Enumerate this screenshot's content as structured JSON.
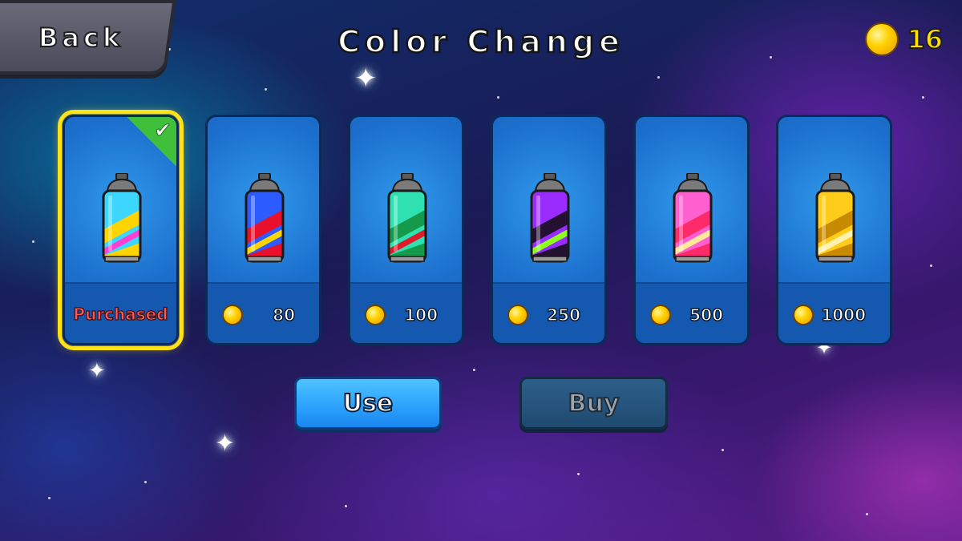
{
  "header": {
    "back_label": "Back",
    "title": "Color Change",
    "coin_balance": "16"
  },
  "cards": [
    {
      "price": "Purchased",
      "status": "purchased",
      "selected": true,
      "colors": [
        "#3cd6ff",
        "#ffd400",
        "#ff3fd0"
      ]
    },
    {
      "price": "80",
      "status": "locked",
      "selected": false,
      "colors": [
        "#2c5bff",
        "#e8102a",
        "#ffd400"
      ]
    },
    {
      "price": "100",
      "status": "locked",
      "selected": false,
      "colors": [
        "#2fe0b0",
        "#149a4a",
        "#e01a2a"
      ]
    },
    {
      "price": "250",
      "status": "locked",
      "selected": false,
      "colors": [
        "#9b2cff",
        "#241030",
        "#8cff1a"
      ]
    },
    {
      "price": "500",
      "status": "locked",
      "selected": false,
      "colors": [
        "#ff5fcf",
        "#ff2a6a",
        "#ffe89a"
      ]
    },
    {
      "price": "1000",
      "status": "locked",
      "selected": false,
      "colors": [
        "#ffcc1a",
        "#c88a00",
        "#fff2b0"
      ]
    }
  ],
  "actions": {
    "use_label": "Use",
    "buy_label": "Buy"
  }
}
